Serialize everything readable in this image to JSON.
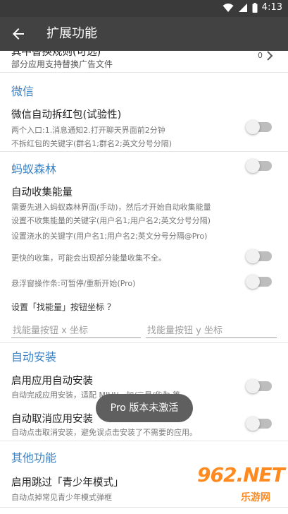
{
  "status": {
    "time": "4:13"
  },
  "toolbar": {
    "title": "扩展功能"
  },
  "top_item": {
    "title": "其中替换规则(可选)",
    "desc": "部分应用支持替换广告文件",
    "count": "0"
  },
  "sections": {
    "wechat": "微信",
    "ant": "蚂蚁森林",
    "auto_install": "自动安装",
    "other": "其他功能"
  },
  "wechat": {
    "title": "微信自动拆红包(试验性)",
    "desc1": "两个入口:1.消息通知2.打开聊天界面前2分钟",
    "desc2": "不拆红包的关键字(群名1;群名2;英文分号分隔)"
  },
  "ant": {
    "collect_title": "自动收集能量",
    "desc1": "需要先进入蚂蚁森林界面(手动)，然后才开始自动收集能量",
    "desc2": "设置不收集能量的关键字(用户名1;用户名2;英文分号分隔)",
    "desc3": "设置浇水的关键字(用户名1;用户名2;英文分号分隔@Pro)",
    "faster": "更快的收集，可能会出现部分能量收集不全。",
    "float": "悬浮窗操作条:可暂停/重新开始(Pro)",
    "coords": "设置「找能量」按钮坐标 ？",
    "x_placeholder": "找能量按钮 x 坐标",
    "y_placeholder": "找能量按钮 y 坐标"
  },
  "install": {
    "enable_title": "启用应用自动安装",
    "enable_desc": "自动完成应用安装，适配 MIUI/一加/三星/华为 等",
    "cancel_title": "自动取消应用安装",
    "cancel_desc": "自动点击取消安装，避免误点击安装了不需要的应用。"
  },
  "other": {
    "teen_title": "启用跳过「青少年模式」",
    "teen_desc": "自动点掉常见青少年模式弹框"
  },
  "toast": "Pro 版本未激活",
  "watermark": {
    "text": "962.NET",
    "cn": "乐游网"
  }
}
